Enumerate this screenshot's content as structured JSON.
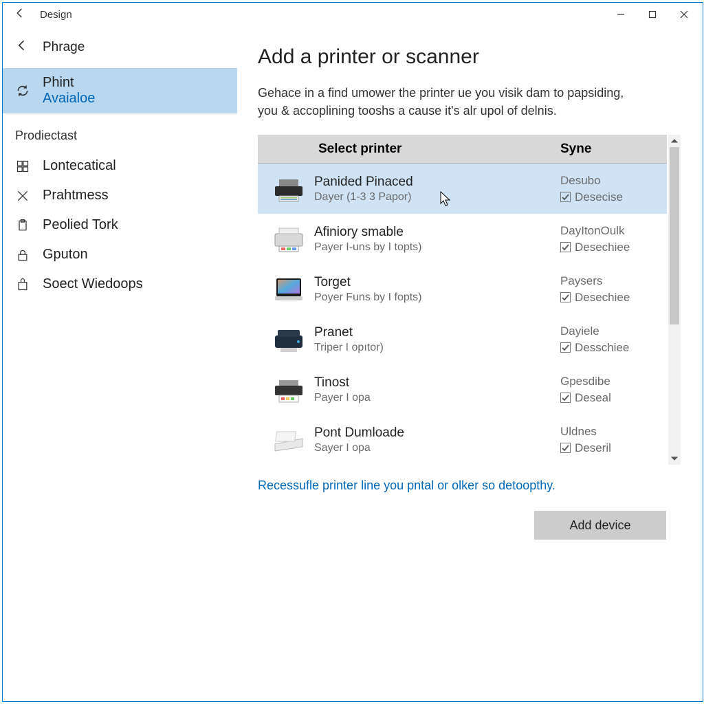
{
  "titlebar": {
    "title": "Design"
  },
  "sidebar": {
    "back_label": "Phrage",
    "selected": {
      "line1": "Phint",
      "line2": "Avaialoe"
    },
    "section_heading": "Prodiectast",
    "items": [
      {
        "label": "Lontecatical"
      },
      {
        "label": "Prahtmess"
      },
      {
        "label": "Peolied Tork"
      },
      {
        "label": "Gputon"
      },
      {
        "label": "Soect Wiedoops"
      }
    ]
  },
  "content": {
    "page_title": "Add a printer or scanner",
    "description": "Gehace in a find umower the printer ue you visik dam to papsiding, you & accoplining tooshs a cause it's alr upol of delnis.",
    "list_header": {
      "col1": "Select printer",
      "col2": "Syne"
    },
    "rows": [
      {
        "name": "Panided Pinaced",
        "sub": "Dayer (1-3 3 Papor)",
        "status": "Desubo",
        "check_label": "Desecise",
        "selected": true
      },
      {
        "name": "Afiniory smable",
        "sub": "Payer I-uns by I topts)",
        "status": "DayItonOulk",
        "check_label": "Desechiee",
        "selected": false
      },
      {
        "name": "Torget",
        "sub": "Poyer Funs by I fopts)",
        "status": "Paysers",
        "check_label": "Desechiee",
        "selected": false
      },
      {
        "name": "Pranet",
        "sub": "Triper I opıtor)",
        "status": "Dayiele",
        "check_label": "Desschiee",
        "selected": false
      },
      {
        "name": "Tinost",
        "sub": "Payer I opa",
        "status": "Gpesdibe",
        "check_label": "Deseal",
        "selected": false
      },
      {
        "name": "Pont Dumloade",
        "sub": "Sayer I opa",
        "status": "Uldnes",
        "check_label": "Deseril",
        "selected": false
      }
    ],
    "footer_link": "Recessufle printer line you pntal or olker so detoopthy.",
    "add_button": "Add device"
  }
}
